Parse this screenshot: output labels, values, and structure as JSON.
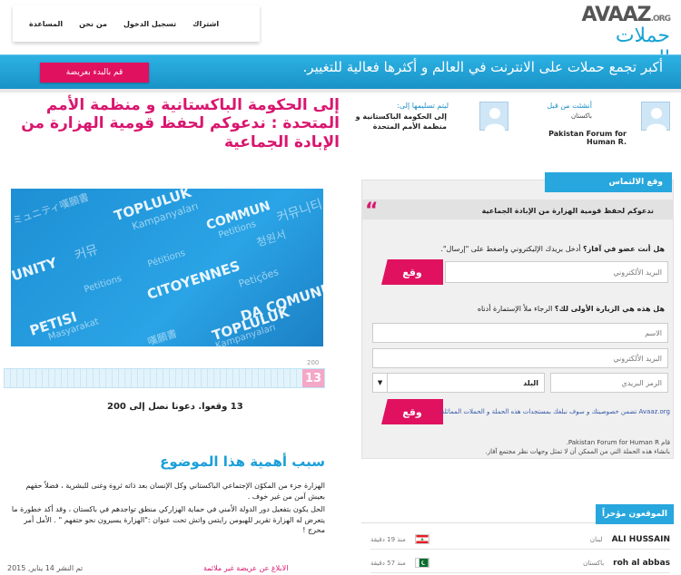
{
  "nav": {
    "signup": "اشتراك",
    "login": "تسجيل الدخول",
    "about": "من نحن",
    "help": "المساعدة"
  },
  "logo": {
    "brand": "AVAAZ",
    "domain": ".ORG",
    "tagline": "حملات المجتمع"
  },
  "banner": {
    "text": "أكبر تجمع حملات على الانترنت في العالم و أكثرها فعالية للتغيير.",
    "start_button": "قم بالبدء بعريضة"
  },
  "petition": {
    "title": "إلى الحكومة الباكستانية و منظمة الأمم المتحدة : ندعوكم لحفظ قومية الهزارة من الإبادة الجماعية",
    "image_words": [
      "TOPLULUK",
      "Kampanyaları",
      "ミュニティ嘆願書",
      "COMMUN",
      "Petitions",
      "커뮤니티",
      "청원서",
      "Pétitions",
      "CITOYENNES",
      "Petições",
      "DA COMUNIDADE",
      "PETISI",
      "Masyarakat",
      "TOPLULUK",
      "Kampanyaları",
      "嘆願書",
      "UNITY",
      "커뮤",
      "Petitions"
    ],
    "progress": {
      "count": "13",
      "max": "200",
      "fraction": 0.065
    },
    "signers_line": "13 وقعوا. دعونا نصل إلى 200",
    "why_heading": "سبب أهمية هذا الموضوع",
    "body": [
      "الهزارة جزء من المكوّن الإجتماعي الباكستاني وكل الإنسان بعد ذاته ثروة وغنى للبشرية ، فضلاً حقهم بعيش آمن من غير خوف .",
      "الحل يكون بتفعيل دور الدولة الأمني في حماية الهزاركي منطق تواجدهم في باكستان ، وقد أكد خطورة ما يتعرض له الهزارة تقرير للهيومن رايتس واتش تحت عنوان :\"الهزارة يسيرون نحو حتفهم \" . الأمل أمر محرج !"
    ],
    "report_link": "الابلاغ عن عريضة غير ملائمة",
    "published": "تم النشر 14 يناير, 2015"
  },
  "starter": {
    "label": "أنشئت من قبل",
    "country": "باكستان",
    "name": "Pakistan Forum for Human R."
  },
  "target": {
    "label": "ليتم تسليمها إلى:",
    "name": "إلى الحكومة الباكستانية و منظمة الأمم المتحدة"
  },
  "sign": {
    "tab": "وقع الالتماس",
    "title": "ندعوكم لحفظ قومية الهزارة من الإبادة الجماعية",
    "member_q_bold": "هل أنت عضو في آفاز؟",
    "member_q": " أدخل بريدك الإليكتروني واضغط على \"إرسال\".",
    "email_placeholder": "البريد الألكتروني",
    "sign_button": "وقع",
    "first_q_bold": "هل هذه هي الزيارة الأولى لك؟",
    "first_q": " الرجاء ملأ الإستمارة أدناه",
    "name_placeholder": "الاسم",
    "email2_placeholder": "البريد الألكتروني",
    "zip_placeholder": "الرمز البريدي",
    "country_select": "البلد",
    "privacy": "Avaaz.org تضمن خصوصيتك و سوف نبلغك بمستجدات هذه الحملة و الحملات المماثلة.",
    "authored_by": "قام Pakistan Forum for Human R.",
    "authored_note": "بانشاء هذه الحملة التي من الممكن أن لا تمثل وجهات نظر مجتمع آفاز."
  },
  "recent": {
    "tab": "الموقعون مؤخراً",
    "rows": [
      {
        "name": "ALI HUSSAIN",
        "country": "لبنان",
        "ago": "منذ 19 دقيقة",
        "flag": "lebanon"
      },
      {
        "name": "roh al abbas",
        "country": "باكستان",
        "ago": "منذ 57 دقيقة",
        "flag": "pakistan"
      }
    ]
  },
  "colors": {
    "brand_blue": "#1aa3d4",
    "accent_pink": "#e0115f",
    "title_pink": "#d9166f"
  }
}
